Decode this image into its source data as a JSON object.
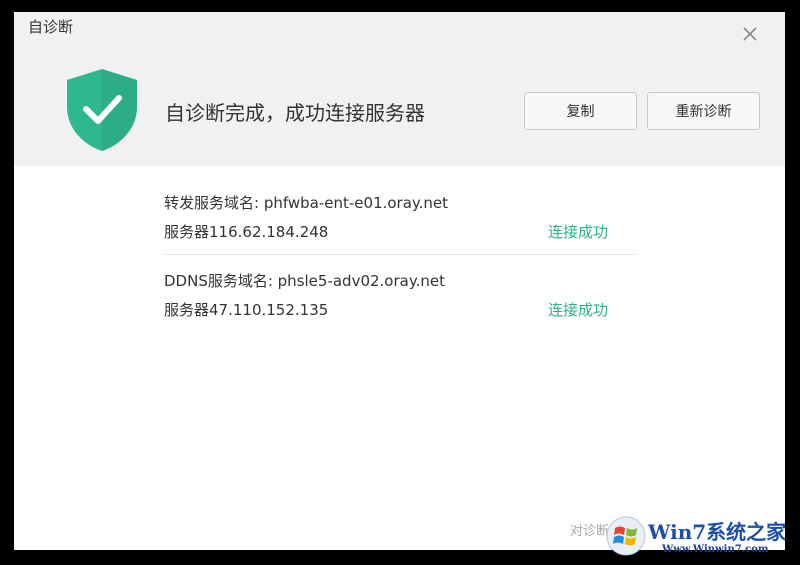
{
  "window": {
    "title": "自诊断",
    "close_icon": "close-icon"
  },
  "header": {
    "shield_icon": "shield-check-icon",
    "status_text": "自诊断完成，成功连接服务器",
    "copy_label": "复制",
    "rediagnose_label": "重新诊断"
  },
  "results": [
    {
      "domain_text": "转发服务域名: phfwba-ent-e01.oray.net",
      "server_text": "服务器116.62.184.248",
      "status_text": "连接成功"
    },
    {
      "domain_text": "DDNS服务域名: phsle5-adv02.oray.net",
      "server_text": "服务器47.110.152.135",
      "status_text": "连接成功"
    }
  ],
  "footer": {
    "text": "对诊断"
  },
  "watermark": {
    "brand": "Win7系统之家",
    "url": "Www.Winwin7.com"
  },
  "colors": {
    "shield": "#2fb88f",
    "success": "#2bb28c",
    "header_bg": "#f1f1f2"
  }
}
